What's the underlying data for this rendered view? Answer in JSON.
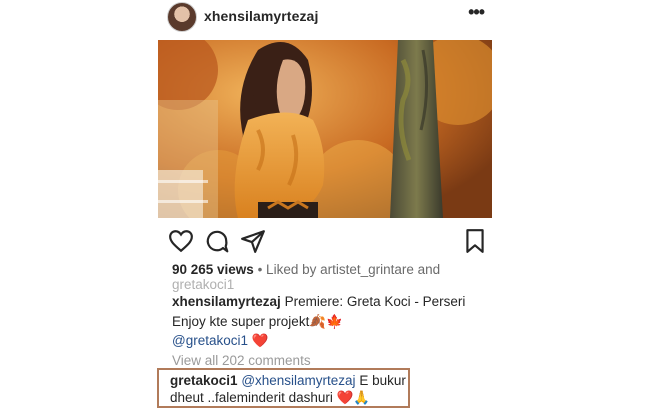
{
  "post": {
    "username": "xhensilamyrtezaj",
    "more_icon": "more-horizontal-icon",
    "colors": {
      "accent": "#b17b5a",
      "mention": "#27508a",
      "heart": "#e0243a"
    }
  },
  "stats": {
    "views": "90 265 views",
    "liked_by": " • Liked by artistet_grintare and",
    "liked_by_2": "gretakoci1"
  },
  "caption": {
    "username": "xhensilamyrtezaj",
    "text": " Premiere: Greta Koci - Perseri",
    "line2": "Enjoy kte super projekt🍂🍁",
    "mention": "@gretakoci1 ❤️"
  },
  "view_all": "View all 202 comments",
  "comment": {
    "username": "gretakoci1",
    "mention": "@xhensilamyrtezaj",
    "text": " E bukur",
    "line2_text": "dheut ..faleminderit dashuri ",
    "line2_emoji": "❤️🙏"
  }
}
